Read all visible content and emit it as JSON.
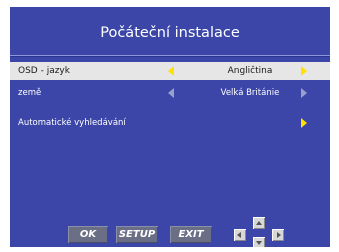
{
  "dialog": {
    "title": "Počáteční instalace"
  },
  "settings": [
    {
      "label": "OSD - jazyk",
      "value": "Angličtina",
      "selected": true
    },
    {
      "label": "země",
      "value": "Velká Británie",
      "selected": false
    },
    {
      "label": "Automatické vyhledávání",
      "value": "",
      "selected": false
    }
  ],
  "footer": {
    "ok_label": "OK",
    "setup_label": "SETUP",
    "exit_label": "EXIT"
  },
  "colors": {
    "panel_bg": "#3b46a8",
    "selected_row_bg": "#e6e6e6",
    "arrow_active": "#ffe000",
    "arrow_inactive": "#9aa0cc",
    "button_bg": "#6a6f86"
  },
  "icons": {
    "left": "arrow-left-icon",
    "right": "arrow-right-icon",
    "up": "nav-up-icon",
    "down": "nav-down-icon"
  }
}
